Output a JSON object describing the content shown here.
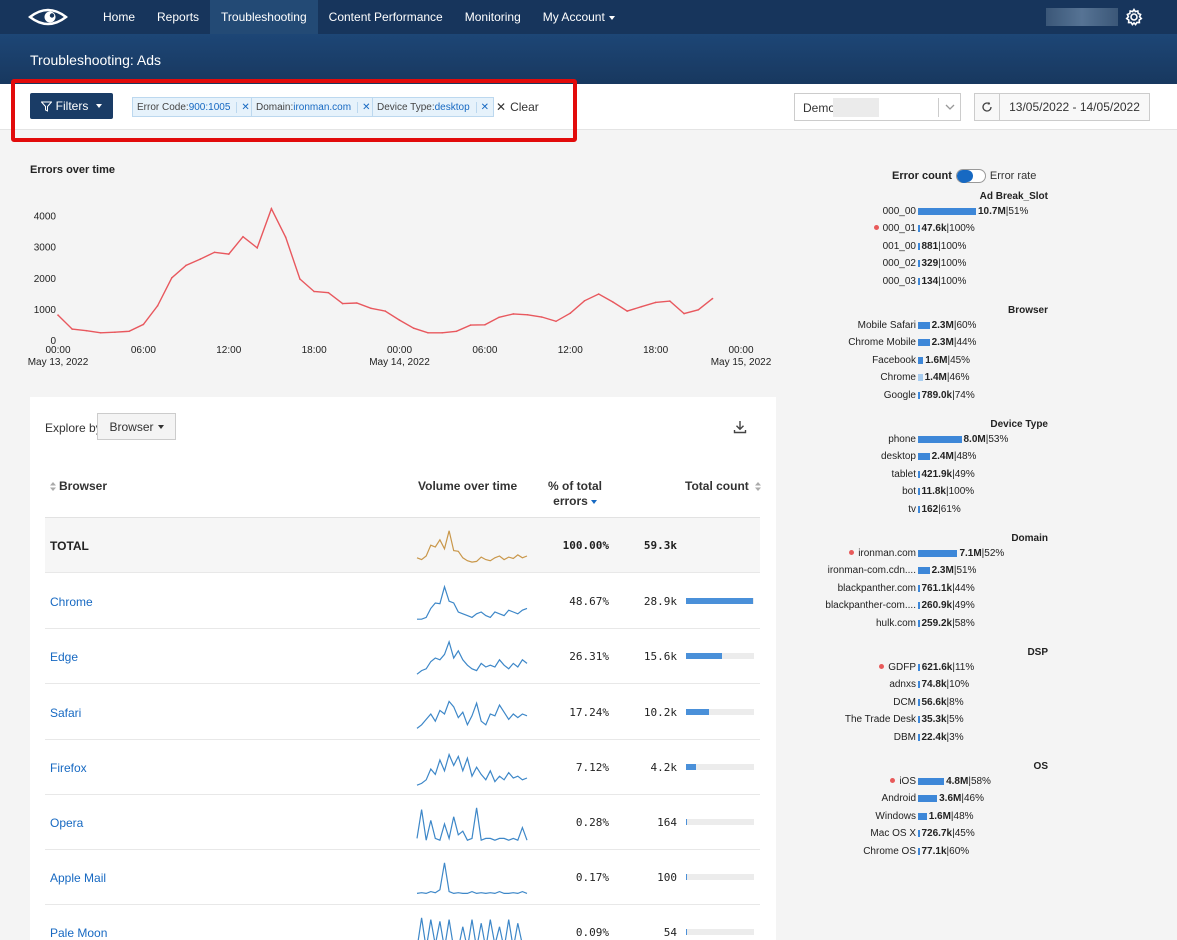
{
  "nav": {
    "logo": "eye-logo",
    "items": [
      {
        "label": "Home",
        "active": false
      },
      {
        "label": "Reports",
        "active": false
      },
      {
        "label": "Troubleshooting",
        "active": true
      },
      {
        "label": "Content Performance",
        "active": false
      },
      {
        "label": "Monitoring",
        "active": false
      },
      {
        "label": "My Account",
        "active": false,
        "dropdown": true
      }
    ]
  },
  "page_title": "Troubleshooting: Ads",
  "filters": {
    "button_label": "Filters",
    "chips": [
      {
        "key": "Error Code:",
        "value": "900:1005"
      },
      {
        "key": "Domain:",
        "value": "ironman.com"
      },
      {
        "key": "Device Type:",
        "value": "desktop"
      }
    ],
    "clear_label": "Clear"
  },
  "account_select": {
    "value": "Demo"
  },
  "date_range": "13/05/2022  -  14/05/2022",
  "chart_data": {
    "type": "line",
    "title": "Errors over time",
    "color": "#e8585e",
    "x_ticks": [
      {
        "label": "00:00",
        "sub": "May 13, 2022",
        "h": 0
      },
      {
        "label": "06:00",
        "sub": "",
        "h": 6
      },
      {
        "label": "12:00",
        "sub": "",
        "h": 12
      },
      {
        "label": "18:00",
        "sub": "",
        "h": 18
      },
      {
        "label": "00:00",
        "sub": "May 14, 2022",
        "h": 24
      },
      {
        "label": "06:00",
        "sub": "",
        "h": 30
      },
      {
        "label": "12:00",
        "sub": "",
        "h": 36
      },
      {
        "label": "18:00",
        "sub": "",
        "h": 42
      },
      {
        "label": "00:00",
        "sub": "May 15, 2022",
        "h": 48
      }
    ],
    "y_ticks": [
      0,
      1000,
      2000,
      3000,
      4000
    ],
    "ylim": [
      0,
      4500
    ],
    "xlim_hours": [
      0,
      48
    ],
    "x_hours": [
      0,
      1,
      2,
      3,
      4,
      5,
      6,
      7,
      8,
      9,
      10,
      11,
      12,
      13,
      14,
      15,
      16,
      17,
      18,
      19,
      20,
      21,
      22,
      23,
      24,
      25,
      26,
      27,
      28,
      29,
      30,
      31,
      32,
      33,
      34,
      35,
      36,
      37,
      38,
      39,
      40,
      41,
      42,
      43,
      44,
      45,
      46,
      47,
      48
    ],
    "values": [
      800,
      350,
      300,
      230,
      250,
      280,
      500,
      1100,
      2000,
      2400,
      2600,
      2820,
      2760,
      3320,
      2960,
      4220,
      3300,
      1960,
      1560,
      1520,
      1170,
      1190,
      1020,
      930,
      640,
      380,
      230,
      230,
      280,
      480,
      490,
      730,
      840,
      810,
      740,
      600,
      860,
      1260,
      1480,
      1220,
      930,
      1070,
      1210,
      1250,
      850,
      970,
      1330
    ]
  },
  "table": {
    "explore_label": "Explore by",
    "explore_value": "Browser",
    "headers": {
      "name": "Browser",
      "volume": "Volume over time",
      "pct": "% of total errors",
      "count": "Total count"
    },
    "rows": [
      {
        "name": "TOTAL",
        "pct": "100.00%",
        "count": "59.3k",
        "share": null,
        "color": "#c9974a",
        "spark": [
          0.2,
          0.15,
          0.25,
          0.55,
          0.5,
          0.7,
          0.45,
          0.95,
          0.4,
          0.38,
          0.2,
          0.12,
          0.08,
          0.1,
          0.22,
          0.15,
          0.12,
          0.2,
          0.25,
          0.15,
          0.22,
          0.18,
          0.28,
          0.2,
          0.25
        ]
      },
      {
        "name": "Chrome",
        "pct": "48.67%",
        "count": "28.9k",
        "share": 0.9867,
        "color": "#3d87c8",
        "spark": [
          0.05,
          0.05,
          0.1,
          0.35,
          0.5,
          0.48,
          0.95,
          0.55,
          0.5,
          0.25,
          0.2,
          0.15,
          0.1,
          0.2,
          0.25,
          0.15,
          0.1,
          0.25,
          0.2,
          0.15,
          0.3,
          0.25,
          0.2,
          0.3,
          0.35
        ]
      },
      {
        "name": "Edge",
        "pct": "26.31%",
        "count": "15.6k",
        "share": 0.5263,
        "color": "#3d87c8",
        "spark": [
          0.05,
          0.15,
          0.2,
          0.4,
          0.5,
          0.45,
          0.6,
          0.95,
          0.5,
          0.7,
          0.45,
          0.3,
          0.2,
          0.15,
          0.35,
          0.25,
          0.3,
          0.25,
          0.45,
          0.3,
          0.2,
          0.35,
          0.25,
          0.45,
          0.35
        ]
      },
      {
        "name": "Safari",
        "pct": "17.24%",
        "count": "10.2k",
        "share": 0.3448,
        "color": "#3d87c8",
        "spark": [
          0.1,
          0.2,
          0.35,
          0.5,
          0.3,
          0.6,
          0.5,
          0.85,
          0.7,
          0.4,
          0.55,
          0.2,
          0.45,
          0.8,
          0.3,
          0.2,
          0.5,
          0.45,
          0.75,
          0.55,
          0.35,
          0.5,
          0.4,
          0.5,
          0.45
        ]
      },
      {
        "name": "Firefox",
        "pct": "7.12%",
        "count": "4.2k",
        "share": 0.1424,
        "color": "#3d87c8",
        "spark": [
          0.05,
          0.1,
          0.2,
          0.5,
          0.35,
          0.75,
          0.45,
          0.9,
          0.6,
          0.85,
          0.45,
          0.8,
          0.3,
          0.55,
          0.35,
          0.2,
          0.45,
          0.15,
          0.3,
          0.2,
          0.4,
          0.25,
          0.3,
          0.2,
          0.25
        ]
      },
      {
        "name": "Opera",
        "pct": "0.28%",
        "count": "164",
        "share": 0.0056,
        "color": "#3d87c8",
        "spark": [
          0.1,
          0.9,
          0.05,
          0.6,
          0.1,
          0.05,
          0.5,
          0.1,
          0.7,
          0.2,
          0.3,
          0.05,
          0.1,
          0.95,
          0.05,
          0.1,
          0.1,
          0.05,
          0.1,
          0.1,
          0.05,
          0.1,
          0.05,
          0.4,
          0.05
        ]
      },
      {
        "name": "Apple Mail",
        "pct": "0.17%",
        "count": "100",
        "share": 0.0034,
        "color": "#3d87c8",
        "spark": [
          0.1,
          0.12,
          0.1,
          0.15,
          0.12,
          0.2,
          0.95,
          0.15,
          0.1,
          0.12,
          0.1,
          0.1,
          0.15,
          0.1,
          0.12,
          0.1,
          0.12,
          0.1,
          0.15,
          0.1,
          0.1,
          0.12,
          0.1,
          0.15,
          0.1
        ]
      },
      {
        "name": "Pale Moon",
        "pct": "0.09%",
        "count": "54",
        "share": 0.0018,
        "color": "#3d87c8",
        "spark": [
          0.1,
          0.95,
          0.1,
          0.9,
          0.2,
          0.85,
          0.1,
          0.9,
          0.1,
          0.1,
          0.7,
          0.1,
          0.9,
          0.1,
          0.8,
          0.1,
          0.9,
          0.2,
          0.7,
          0.1,
          0.9,
          0.1,
          0.8,
          0.2,
          0.1
        ]
      }
    ]
  },
  "right_panel": {
    "toggle": {
      "on_label": "Error count",
      "off_label": "Error rate"
    },
    "groups": [
      {
        "title": "Ad Break_Slot",
        "rows": [
          {
            "label": "000_00",
            "value": "10.7M",
            "rate": "51%",
            "share": 1.0,
            "dot": false,
            "light": false
          },
          {
            "label": "000_01",
            "value": "47.6k",
            "rate": "100%",
            "share": 0.004,
            "dot": true,
            "light": false
          },
          {
            "label": "001_00",
            "value": "881",
            "rate": "100%",
            "share": 0,
            "dot": false,
            "light": false
          },
          {
            "label": "000_02",
            "value": "329",
            "rate": "100%",
            "share": 0,
            "dot": false,
            "light": false
          },
          {
            "label": "000_03",
            "value": "134",
            "rate": "100%",
            "share": 0,
            "dot": false,
            "light": false
          }
        ]
      },
      {
        "title": "Browser",
        "rows": [
          {
            "label": "Mobile Safari",
            "value": "2.3M",
            "rate": "60%",
            "share": 0.2,
            "dot": false,
            "light": false
          },
          {
            "label": "Chrome Mobile",
            "value": "2.3M",
            "rate": "44%",
            "share": 0.2,
            "dot": false,
            "light": false
          },
          {
            "label": "Facebook",
            "value": "1.6M",
            "rate": "45%",
            "share": 0.09,
            "dot": false,
            "light": false
          },
          {
            "label": "Chrome",
            "value": "1.4M",
            "rate": "46%",
            "share": 0.08,
            "dot": false,
            "light": true
          },
          {
            "label": "Google",
            "value": "789.0k",
            "rate": "74%",
            "share": 0,
            "dot": false,
            "light": false
          }
        ]
      },
      {
        "title": "Device Type",
        "rows": [
          {
            "label": "phone",
            "value": "8.0M",
            "rate": "53%",
            "share": 0.75,
            "dot": false,
            "light": false
          },
          {
            "label": "desktop",
            "value": "2.4M",
            "rate": "48%",
            "share": 0.2,
            "dot": false,
            "light": false
          },
          {
            "label": "tablet",
            "value": "421.9k",
            "rate": "49%",
            "share": 0.02,
            "dot": false,
            "light": false
          },
          {
            "label": "bot",
            "value": "11.8k",
            "rate": "100%",
            "share": 0,
            "dot": false,
            "light": false
          },
          {
            "label": "tv",
            "value": "162",
            "rate": "61%",
            "share": 0,
            "dot": false,
            "light": false
          }
        ]
      },
      {
        "title": "Domain",
        "rows": [
          {
            "label": "ironman.com",
            "value": "7.1M",
            "rate": "52%",
            "share": 0.68,
            "dot": true,
            "light": false
          },
          {
            "label": "ironman-com.cdn....",
            "value": "2.3M",
            "rate": "51%",
            "share": 0.2,
            "dot": false,
            "light": false
          },
          {
            "label": "blackpanther.com",
            "value": "761.1k",
            "rate": "44%",
            "share": 0.02,
            "dot": false,
            "light": false
          },
          {
            "label": "blackpanther-com....",
            "value": "260.9k",
            "rate": "49%",
            "share": 0.02,
            "dot": false,
            "light": false
          },
          {
            "label": "hulk.com",
            "value": "259.2k",
            "rate": "58%",
            "share": 0,
            "dot": false,
            "light": false
          }
        ]
      },
      {
        "title": "DSP",
        "rows": [
          {
            "label": "GDFP",
            "value": "621.6k",
            "rate": "11%",
            "share": 0.03,
            "dot": true,
            "light": false
          },
          {
            "label": "adnxs",
            "value": "74.8k",
            "rate": "10%",
            "share": 0,
            "dot": false,
            "light": false
          },
          {
            "label": "DCM",
            "value": "56.6k",
            "rate": "8%",
            "share": 0,
            "dot": false,
            "light": false
          },
          {
            "label": "The Trade Desk",
            "value": "35.3k",
            "rate": "5%",
            "share": 0,
            "dot": false,
            "light": false
          },
          {
            "label": "DBM",
            "value": "22.4k",
            "rate": "3%",
            "share": 0,
            "dot": false,
            "light": false
          }
        ]
      },
      {
        "title": "OS",
        "rows": [
          {
            "label": "iOS",
            "value": "4.8M",
            "rate": "58%",
            "share": 0.45,
            "dot": true,
            "light": false
          },
          {
            "label": "Android",
            "value": "3.6M",
            "rate": "46%",
            "share": 0.33,
            "dot": false,
            "light": false
          },
          {
            "label": "Windows",
            "value": "1.6M",
            "rate": "48%",
            "share": 0.15,
            "dot": false,
            "light": false
          },
          {
            "label": "Mac OS X",
            "value": "726.7k",
            "rate": "45%",
            "share": 0.02,
            "dot": false,
            "light": false
          },
          {
            "label": "Chrome OS",
            "value": "77.1k",
            "rate": "60%",
            "share": 0,
            "dot": false,
            "light": false
          }
        ]
      }
    ]
  }
}
